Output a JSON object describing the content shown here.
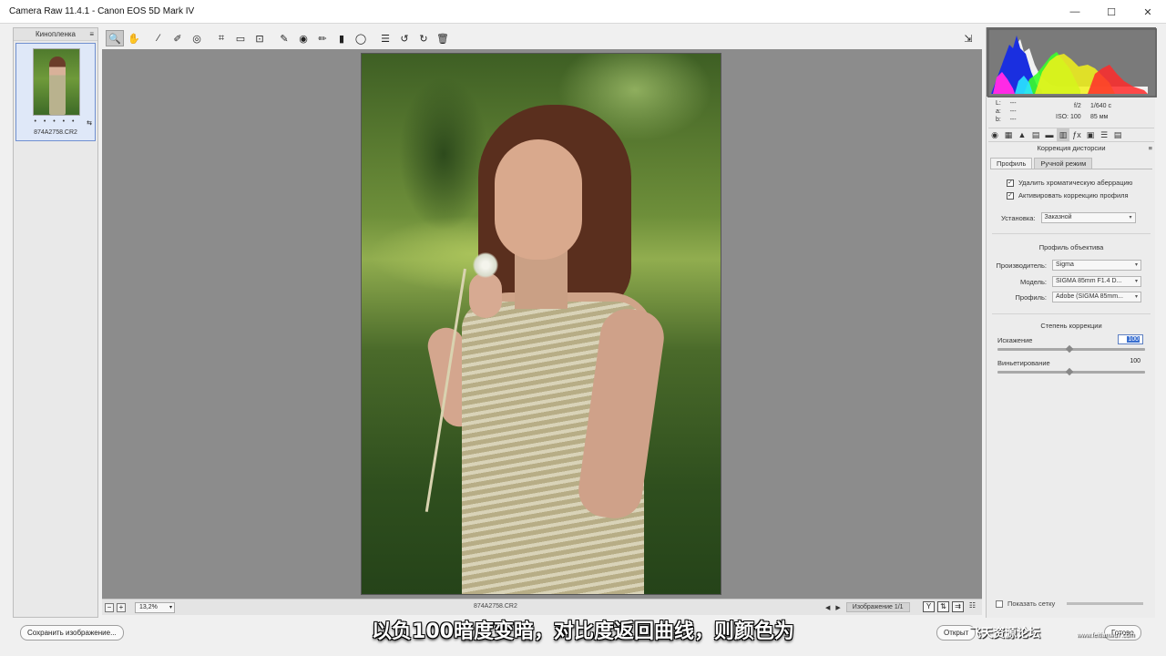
{
  "window": {
    "title": "Camera Raw 11.4.1  -  Canon EOS 5D Mark IV"
  },
  "filmstrip": {
    "header": "Кинопленка",
    "items": [
      {
        "filename": "874A2758.CR2",
        "stars": "• • • • •"
      }
    ]
  },
  "toolbar": {
    "tools": [
      {
        "name": "zoom-tool",
        "glyph": "🔍"
      },
      {
        "name": "hand-tool",
        "glyph": "✋"
      },
      {
        "name": "white-balance-tool",
        "glyph": "⁄"
      },
      {
        "name": "color-sampler-tool",
        "glyph": "✐"
      },
      {
        "name": "targeted-adjustment-tool",
        "glyph": "◎"
      },
      {
        "name": "crop-tool",
        "glyph": "⌗"
      },
      {
        "name": "straighten-tool",
        "glyph": "▭"
      },
      {
        "name": "transform-tool",
        "glyph": "⊡"
      },
      {
        "name": "spot-removal-tool",
        "glyph": "✎"
      },
      {
        "name": "red-eye-tool",
        "glyph": "◉"
      },
      {
        "name": "adjustment-brush-tool",
        "glyph": "✏"
      },
      {
        "name": "graduated-filter-tool",
        "glyph": "▮"
      },
      {
        "name": "radial-filter-tool",
        "glyph": "◯"
      },
      {
        "name": "presets-list-tool",
        "glyph": "☰"
      },
      {
        "name": "rotate-left-tool",
        "glyph": "↺"
      },
      {
        "name": "rotate-right-tool",
        "glyph": "↻"
      },
      {
        "name": "delete-tool",
        "glyph": "🗑"
      }
    ]
  },
  "histogram": {
    "readout_labels": [
      "L:",
      "a:",
      "b:"
    ],
    "readout_values": [
      "---",
      "---",
      "---"
    ],
    "aperture": "f/2",
    "shutter": "1/640 с",
    "iso": "ISO: 100",
    "focal": "85 мм"
  },
  "panel": {
    "title": "Коррекция дисторсии",
    "tabs": [
      "Профиль",
      "Ручной режим"
    ],
    "checkboxes": [
      {
        "label": "Удалить хроматическую аберрацию",
        "checked": true
      },
      {
        "label": "Активировать коррекцию профиля",
        "checked": true
      }
    ],
    "setup_label": "Установка:",
    "setup_value": "Заказной",
    "lens_profile_heading": "Профиль объектива",
    "make_label": "Производитель:",
    "make_value": "Sigma",
    "model_label": "Модель:",
    "model_value": "SIGMA 85mm F1.4 D...",
    "profile_label": "Профиль:",
    "profile_value": "Adobe (SIGMA 85mm...",
    "amount_heading": "Степень коррекции",
    "distortion_label": "Искажение",
    "distortion_value": "100",
    "vignetting_label": "Виньетирование",
    "vignetting_value": "100",
    "grid_label": "Показать сетку"
  },
  "statusbar": {
    "zoom": "13,2%",
    "filename": "874A2758.CR2",
    "counter": "Изображение 1/1"
  },
  "bottom": {
    "save_button": "Сохранить изображение...",
    "open_button": "Открыт",
    "done_button": "Готово"
  },
  "overlay": {
    "subtitle": "以负100暗度变暗，对比度返回曲线，则颜色为",
    "watermark": "飞天资源论坛",
    "watermark_url": "www.feitianwu7.com"
  },
  "colors": {
    "canvas_bg": "#8c8c8c",
    "selection": "#3a6fd0"
  }
}
